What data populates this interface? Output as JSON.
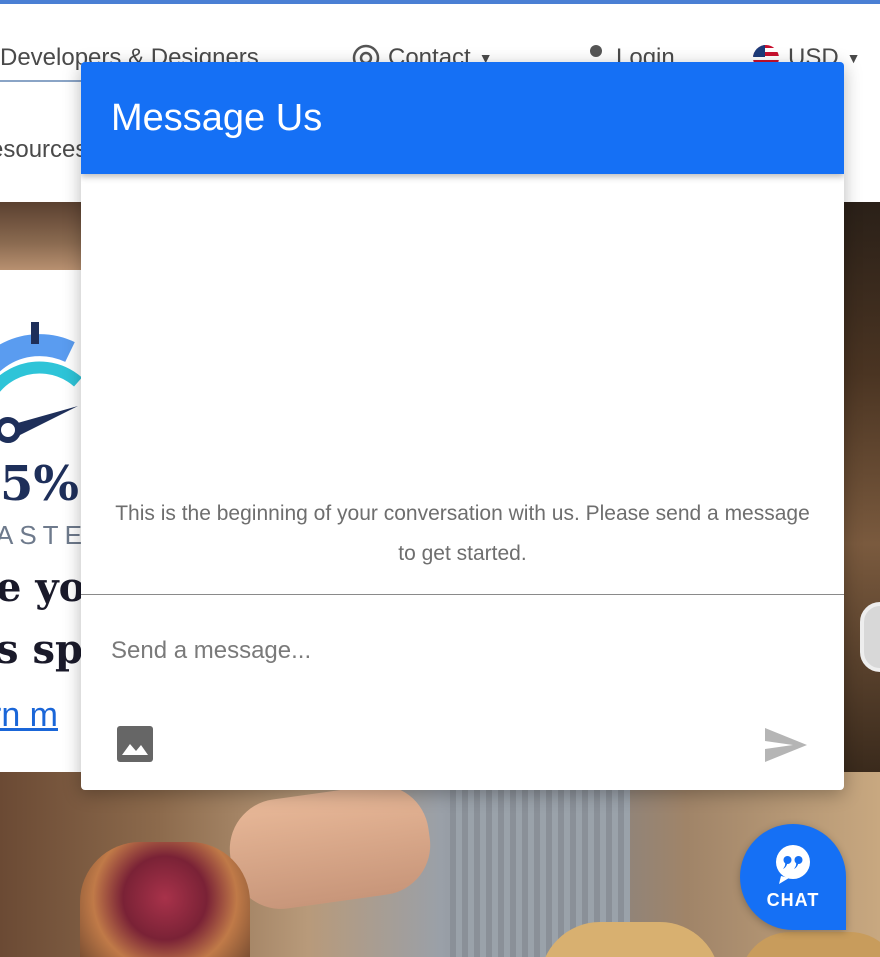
{
  "site": {
    "nav": {
      "developers_label": "Developers & Designers",
      "contact_label": "Contact",
      "login_label": "Login",
      "currency_label": "USD",
      "resources_label": "esources"
    },
    "hero": {
      "speed_text": "5%",
      "faster_text": "ASTE",
      "headline_line1": "e yo",
      "headline_line2": "s sp",
      "learn_more_link": "rn m"
    }
  },
  "chat": {
    "header_title": "Message Us",
    "intro_text": "This is the beginning of your conversation with us. Please send a message to get started.",
    "input": {
      "value": "",
      "placeholder": "Send a message..."
    },
    "image_upload_icon": "image-icon",
    "send_icon": "send-icon",
    "launcher": {
      "label": "CHAT",
      "icon": "quote-bubble-icon"
    }
  },
  "colors": {
    "chat_blue": "#1570f5",
    "top_accent": "#4a7fd4",
    "link_blue": "#1a66d8",
    "intro_text": "#6e6e6e"
  }
}
